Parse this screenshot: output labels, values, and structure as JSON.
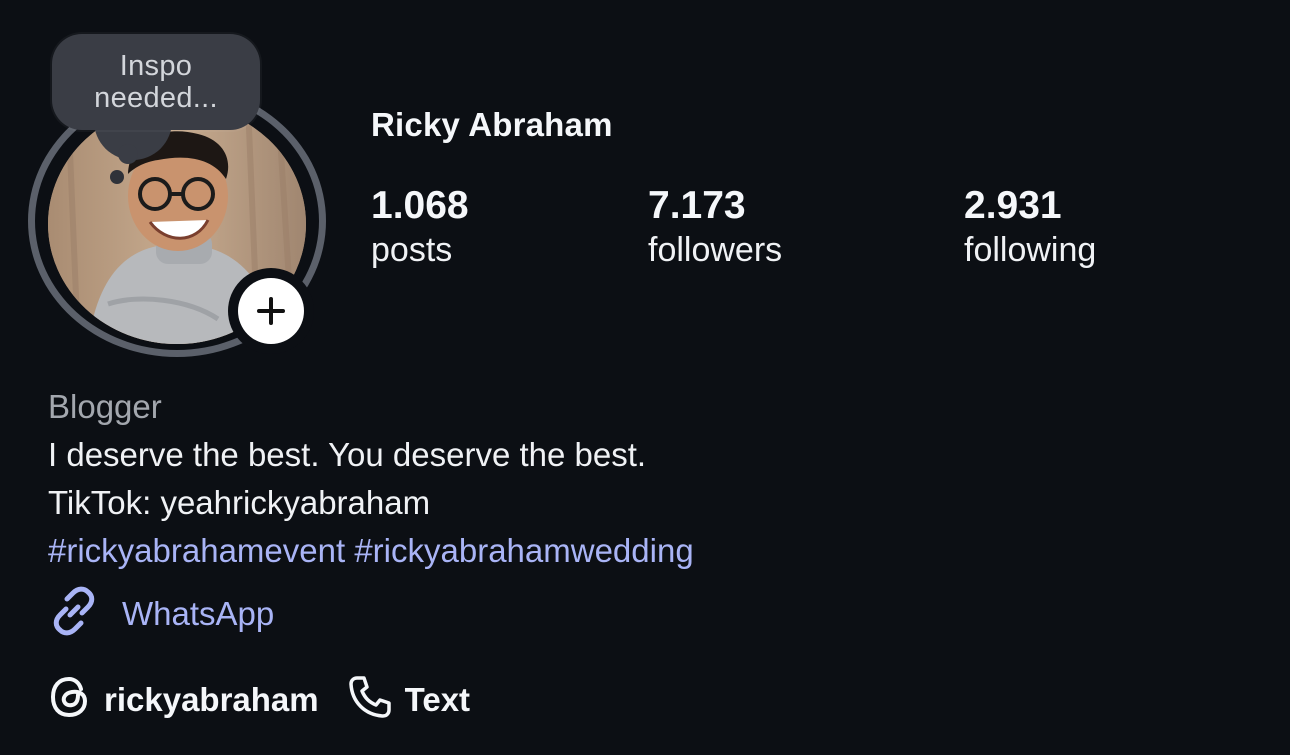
{
  "profile": {
    "name": "Ricky Abraham",
    "note_lines": [
      "Inspo",
      "needed..."
    ]
  },
  "stats": [
    {
      "value": "1.068",
      "label": "posts"
    },
    {
      "value": "7.173",
      "label": "followers"
    },
    {
      "value": "2.931",
      "label": "following"
    }
  ],
  "bio": {
    "category": "Blogger",
    "line1": "I deserve the best. You deserve the best.",
    "line2": "TikTok: yeahrickyabraham",
    "hashtags": [
      "#rickyabrahamevent",
      "#rickyabrahamwedding"
    ]
  },
  "link": {
    "icon": "link-icon",
    "label": "WhatsApp"
  },
  "actions": {
    "threads": {
      "icon": "threads-icon",
      "label": "rickyabraham"
    },
    "text": {
      "icon": "phone-icon",
      "label": "Text"
    }
  },
  "colors": {
    "background": "#0c0f14",
    "link": "#a9b4f6",
    "muted": "#a3a7ae",
    "note_bubble": "#3a3d45",
    "avatar_ring": "#5b606a"
  }
}
